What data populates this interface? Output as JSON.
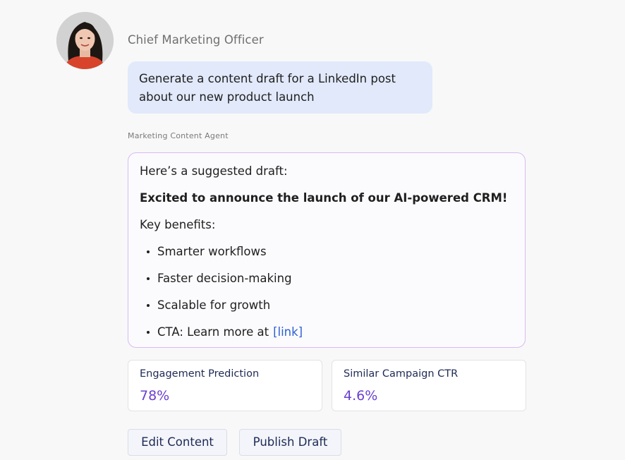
{
  "conversation": {
    "user": {
      "name": "Chief Marketing Officer",
      "message": "Generate a content draft for a LinkedIn post about our new product launch"
    },
    "agent": {
      "label": "Marketing Content Agent",
      "intro": "Here’s a suggested draft:",
      "headline": "Excited to announce the launch of our AI-powered CRM!",
      "benefits_label": "Key benefits:",
      "bullets": [
        "Smarter workflows",
        "Faster decision-making",
        "Scalable for growth",
        "CTA: Learn more at"
      ],
      "link_text": "[link]"
    }
  },
  "metrics": [
    {
      "title": "Engagement Prediction",
      "value": "78%"
    },
    {
      "title": "Similar Campaign CTR",
      "value": "4.6%"
    }
  ],
  "actions": {
    "edit_label": "Edit Content",
    "publish_label": "Publish Draft"
  },
  "colors": {
    "user_bubble": "#e1e9fb",
    "agent_border": "#d9b9f2",
    "metric_value": "#6a3fd0",
    "link": "#2d5fd1",
    "button_bg": "#f3f5fa"
  },
  "icons": {
    "avatar": "user-avatar-photo"
  }
}
